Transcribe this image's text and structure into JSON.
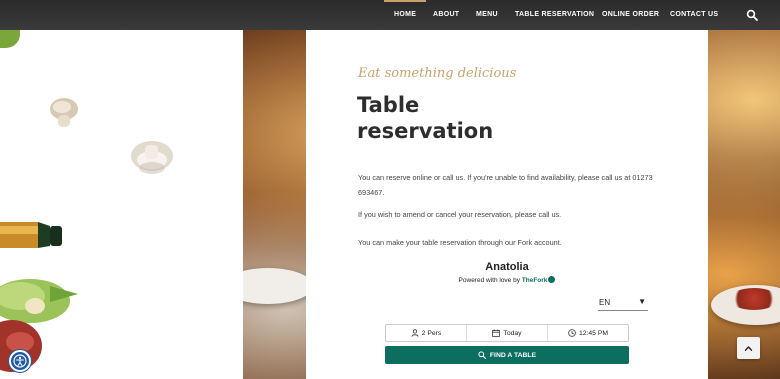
{
  "nav": {
    "items": [
      {
        "label": "HOME",
        "active": true
      },
      {
        "label": "ABOUT",
        "active": false
      },
      {
        "label": "MENU",
        "active": false
      },
      {
        "label": "TABLE RESERVATION",
        "active": false
      },
      {
        "label": "ONLINE ORDER",
        "active": false
      },
      {
        "label": "CONTACT US",
        "active": false
      }
    ],
    "search_icon": "search-icon"
  },
  "content": {
    "tagline": "Eat something delicious",
    "heading": "Table reservation",
    "paragraph_1": "You can reserve online or call us. If you're unable to find availability, please call us at 01273 693467.",
    "paragraph_2": "If you wish to amend or cancel your reservation, please call us.",
    "paragraph_3": "You can make your table reservation through our Fork account."
  },
  "widget": {
    "restaurant_name": "Anatolia",
    "powered_prefix": "Powered with love by",
    "powered_brand": "TheFork",
    "language": "EN",
    "people": "2 Pers",
    "date": "Today",
    "time": "12:45 PM",
    "find_button": "FIND A TABLE",
    "brand_color": "#0b6e5f"
  },
  "colors": {
    "nav_bg": "#2b2b2b",
    "accent_gold": "#c9a26b",
    "accessibility_blue": "#1f5aa8"
  }
}
